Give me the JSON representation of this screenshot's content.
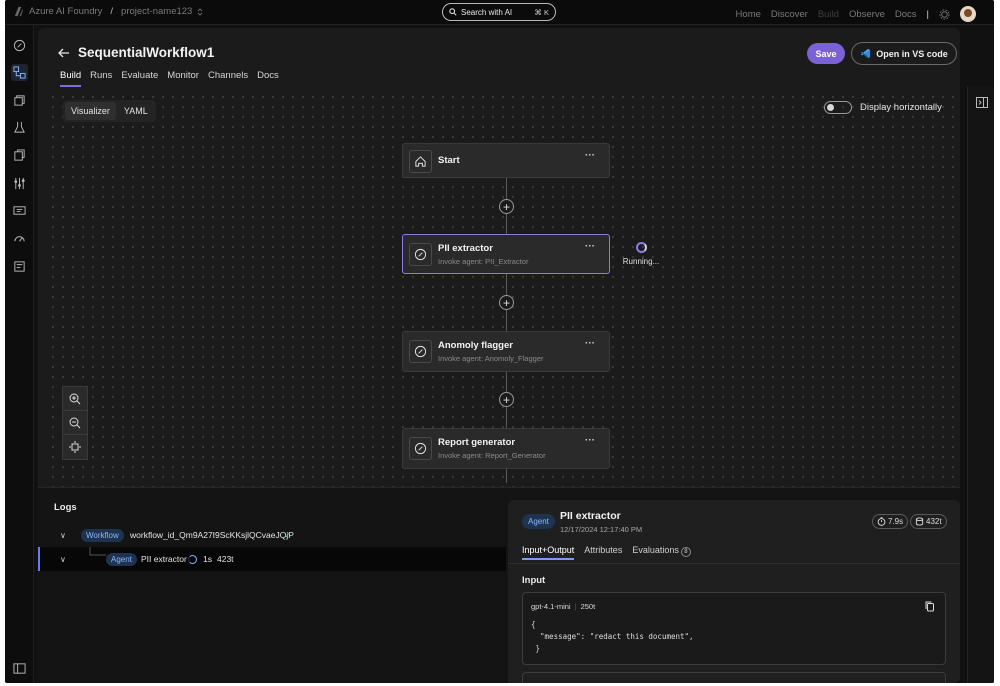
{
  "topbar": {
    "brand": "Azure AI Foundry",
    "separator": "/",
    "project": "project-name123",
    "search_label": "Search with AI",
    "search_shortcut": "⌘ K",
    "nav": [
      "Home",
      "Discover",
      "Build",
      "Observe",
      "Docs"
    ]
  },
  "header": {
    "title": "SequentialWorkflow1",
    "tabs": [
      "Build",
      "Runs",
      "Evaluate",
      "Monitor",
      "Channels",
      "Docs"
    ],
    "save": "Save",
    "open_vscode": "Open in VS code"
  },
  "canvas": {
    "view_tabs": [
      "Visualizer",
      "YAML"
    ],
    "toggle_label": "Display horizontally",
    "nodes": [
      {
        "title": "Start",
        "subtitle": ""
      },
      {
        "title": "PII extractor",
        "subtitle": "Invoke agent: PII_Extractor"
      },
      {
        "title": "Anomoly flagger",
        "subtitle": "Invoke agent: Anomoly_Flagger"
      },
      {
        "title": "Report generator",
        "subtitle": "Invoke agent: Report_Generator"
      }
    ],
    "status": "Running..."
  },
  "logs": {
    "title": "Logs",
    "workflow_pill": "Workflow",
    "workflow_id": "workflow_id_Qm9A27I9ScKKsjlQCvaeJQjP",
    "agent_pill": "Agent",
    "agent_name": "PII extractor",
    "agent_time": "1s",
    "agent_tokens": "423t"
  },
  "detail": {
    "pill": "Agent",
    "title": "PII extractor",
    "timestamp": "12/17/2024 12:17:40 PM",
    "duration": "7.9s",
    "tokens": "432t",
    "tabs": [
      "Input+Output",
      "Attributes",
      "Evaluations"
    ],
    "evaluations_count": "8",
    "input_heading": "Input",
    "model": "gpt-4.1-mini",
    "model_tokens": "250t",
    "code": "{\n  \"message\": \"redact this document\",\n }"
  }
}
